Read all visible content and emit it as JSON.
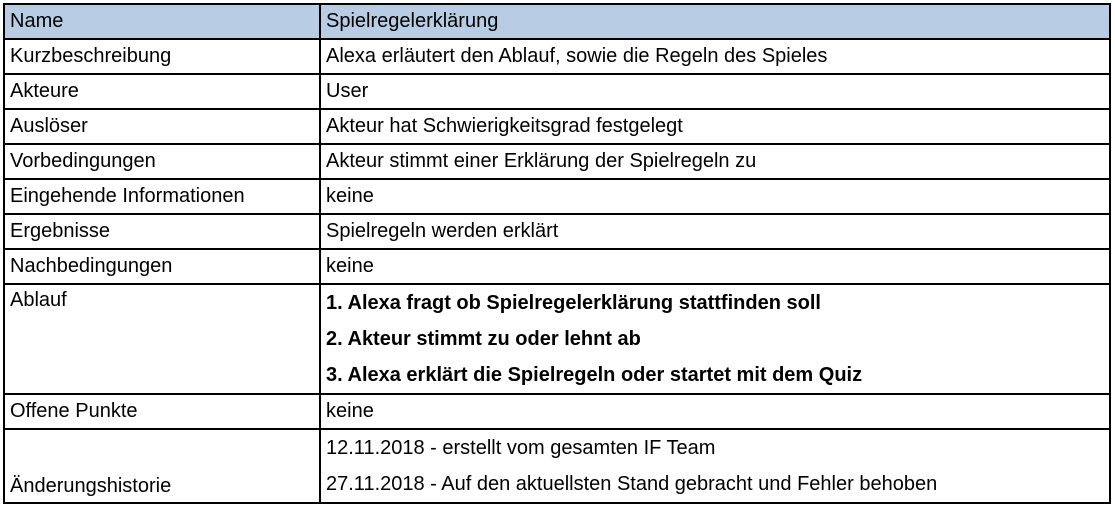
{
  "table": {
    "header": {
      "label": "Name",
      "value": "Spielregelerklärung"
    },
    "rows": [
      {
        "label": "Kurzbeschreibung",
        "value": "Alexa erläutert den Ablauf, sowie die Regeln des Spieles"
      },
      {
        "label": "Akteure",
        "value": "User"
      },
      {
        "label": "Auslöser",
        "value": "Akteur hat Schwierigkeitsgrad festgelegt"
      },
      {
        "label": "Vorbedingungen",
        "value": "Akteur stimmt einer Erklärung der Spielregeln zu"
      },
      {
        "label": "Eingehende Informationen",
        "value": "keine"
      },
      {
        "label": "Ergebnisse",
        "value": "Spielregeln werden erklärt"
      },
      {
        "label": "Nachbedingungen",
        "value": "keine"
      }
    ],
    "ablauf": {
      "label": "Ablauf",
      "steps": [
        "1. Alexa fragt ob Spielregelerklärung stattfinden soll",
        "2. Akteur stimmt zu oder lehnt ab",
        "3. Alexa erklärt die Spielregeln oder startet mit dem Quiz"
      ]
    },
    "offene_punkte": {
      "label": "Offene Punkte",
      "value": "keine"
    },
    "historie": {
      "label": "Änderungshistorie",
      "entries": [
        "12.11.2018 - erstellt vom gesamten IF Team",
        "27.11.2018 - Auf den aktuellsten Stand gebracht und Fehler behoben"
      ]
    }
  }
}
